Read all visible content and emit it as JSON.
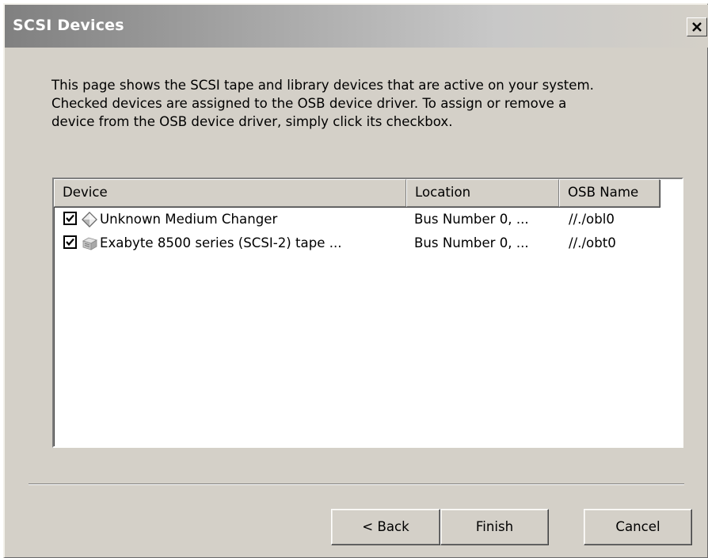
{
  "window": {
    "title": "SCSI Devices",
    "close_glyph": "X"
  },
  "description": {
    "lines": [
      "This page shows the SCSI tape and library devices that are active on your system.",
      "Checked devices are assigned to the OSB device driver. To assign or remove a",
      "device from the OSB device driver, simply click its checkbox."
    ]
  },
  "listview": {
    "columns": [
      "Device",
      "Location",
      "OSB Name"
    ],
    "rows": [
      {
        "checked": true,
        "icon": "medium-changer-icon",
        "device": "Unknown Medium Changer",
        "location": "Bus Number 0, ...",
        "osb_name": "//./obl0"
      },
      {
        "checked": true,
        "icon": "tape-drive-icon",
        "device": "Exabyte 8500 series (SCSI-2) tape ...",
        "location": "Bus Number 0, ...",
        "osb_name": "//./obt0"
      }
    ]
  },
  "buttons": {
    "back": "< Back",
    "finish": "Finish",
    "cancel": "Cancel"
  },
  "colors": {
    "dialog_face": "#d4d0c8",
    "title_start": "#808080",
    "title_text": "#ffffff"
  }
}
